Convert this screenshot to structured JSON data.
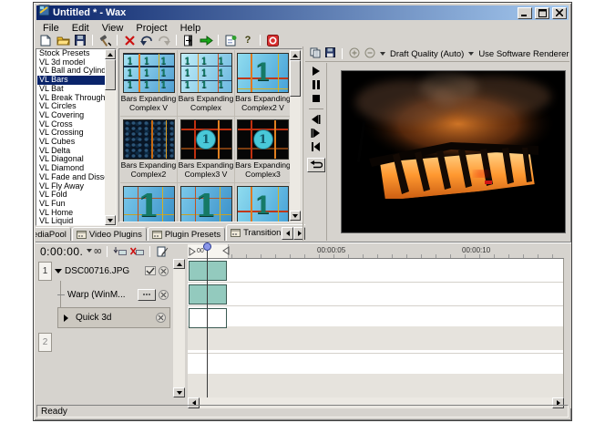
{
  "window": {
    "title": "Untitled * - Wax"
  },
  "menu": {
    "items": [
      "File",
      "Edit",
      "View",
      "Project",
      "Help"
    ]
  },
  "main_toolbar": {
    "icons": [
      "new",
      "open",
      "save",
      "plugin-tools",
      "delete",
      "undo",
      "redo",
      "exit",
      "run",
      "properties",
      "help",
      "record"
    ]
  },
  "glyphs": {
    "help": "?"
  },
  "preset_list": {
    "selected": "VL Bars",
    "items": [
      "Stock Presets",
      "VL 3d model",
      "VL Ball and Cylinde",
      "VL Bars",
      "VL Bat",
      "VL Break Through",
      "VL Circles",
      "VL Covering",
      "VL Cross",
      "VL Crossing",
      "VL Cubes",
      "VL Delta",
      "VL Diagonal",
      "VL Diamond",
      "VL Fade and Disso",
      "VL Fly Away",
      "VL Fold",
      "VL Fun",
      "VL Home",
      "VL Liquid"
    ]
  },
  "thumbs": {
    "glyph9": "1 1 1\n1 1 1\n1 1 1",
    "glyph1": "1",
    "items": [
      {
        "label": "Bars Expanding Complex V",
        "variant": "grid9"
      },
      {
        "label": "Bars Expanding Complex",
        "variant": "grid9b"
      },
      {
        "label": "Bars Expanding Complex2 V",
        "variant": "single"
      },
      {
        "label": "Bars Expanding Complex2",
        "variant": "texture"
      },
      {
        "label": "Bars Expanding Complex3 V",
        "variant": "darkcircle"
      },
      {
        "label": "Bars Expanding Complex3",
        "variant": "darkcircle"
      }
    ]
  },
  "tabs": {
    "active": "Transition Presets",
    "items": [
      "MediaPool",
      "Video Plugins",
      "Plugin Presets",
      "Transition Presets"
    ]
  },
  "preview": {
    "quality": "Draft Quality (Auto)",
    "renderer": "Use Software Renderer",
    "toolbar_icons": [
      "copy",
      "save",
      "zoom-in",
      "zoom-out"
    ],
    "transport_icons": [
      "play",
      "pause",
      "stop",
      "step-back",
      "step-forward",
      "go-start",
      "loop"
    ]
  },
  "timeline": {
    "timecode": "0:00:00.",
    "frames": "00",
    "in_marker": "00",
    "ruler_labels": [
      "00:00:05",
      "00:00:10"
    ],
    "tracks": [
      {
        "num": "1",
        "label": "DSC00716.JPG"
      },
      {
        "num": "",
        "label": "Warp (WinM..."
      },
      {
        "num": "",
        "label": "Quick 3d"
      },
      {
        "num": "2",
        "label": ""
      }
    ]
  },
  "statusbar": {
    "text": "Ready"
  },
  "colors": {
    "titlebar_start": "#0a246a",
    "titlebar_end": "#a6caf0",
    "selection": "#0a246a",
    "clip": "#93cabe",
    "chrome": "#d6d3ce"
  }
}
